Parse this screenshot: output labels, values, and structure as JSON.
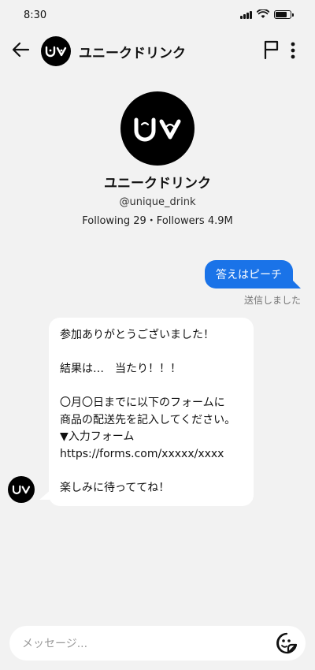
{
  "status_bar": {
    "time": "8:30"
  },
  "header": {
    "title": "ユニークドリンク"
  },
  "profile": {
    "name": "ユニークドリンク",
    "handle": "@unique_drink",
    "stats": "Following 29・Followers 4.9M"
  },
  "messages": {
    "outgoing": {
      "text": "答えはピーチ",
      "status": "送信しました"
    },
    "incoming": {
      "text": "参加ありがとうございました！\n\n結果は…　当たり！！！\n\n〇月〇日までに以下のフォームに\n商品の配送先を記入してください。\n▼入力フォーム\nhttps://forms.com/xxxxx/xxxx\n\n楽しみに待っててね！"
    }
  },
  "composer": {
    "placeholder": "メッセージ..."
  },
  "colors": {
    "accent": "#1a73e8",
    "background": "#f2f2f2",
    "bubble_in": "#ffffff"
  },
  "icons": {
    "back": "arrow-left-icon",
    "flag": "flag-icon",
    "more": "more-vertical-icon",
    "sticker": "sticker-icon",
    "avatar_logo": "uv-smile-logo"
  }
}
